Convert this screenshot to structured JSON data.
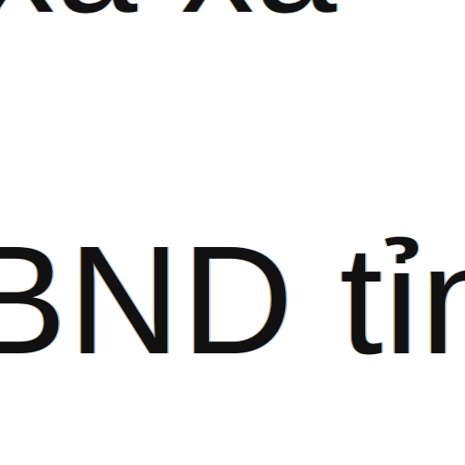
{
  "document": {
    "lines": [
      {
        "text": "xã  xã"
      },
      {
        "text": "BND tỉn"
      }
    ]
  },
  "colors": {
    "background": "#ffffff",
    "text": "#111111"
  }
}
